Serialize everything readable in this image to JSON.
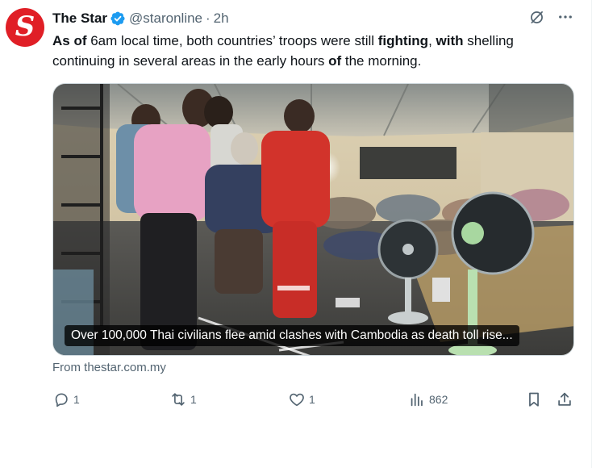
{
  "account": {
    "display_name": "The Star",
    "handle": "@staronline",
    "separator": "·",
    "time": "2h",
    "avatar_letter": "S",
    "avatar_color": "#e01f26",
    "verified_color": "#1d9bf0"
  },
  "tweet": {
    "segments": [
      {
        "text": "As of",
        "bold": true
      },
      {
        "text": " 6am local time, both countries’ troops were still ",
        "bold": false
      },
      {
        "text": "fighting",
        "bold": true
      },
      {
        "text": ", ",
        "bold": false
      },
      {
        "text": "with",
        "bold": true
      },
      {
        "text": " shelling continuing in several areas in the early hours ",
        "bold": false
      },
      {
        "text": "of",
        "bold": true
      },
      {
        "text": " the morning.",
        "bold": false
      }
    ]
  },
  "card": {
    "caption": "Over 100,000 Thai civilians flee amid clashes with Cambodia as death toll rise...",
    "source": "From thestar.com.my"
  },
  "actions": {
    "reply_count": "1",
    "repost_count": "1",
    "like_count": "1",
    "views_count": "862"
  },
  "icons": {
    "grok": "grok-icon",
    "more": "more-icon",
    "reply": "reply-icon",
    "repost": "repost-icon",
    "like": "like-icon",
    "views": "views-icon",
    "bookmark": "bookmark-icon",
    "share": "share-icon"
  },
  "colors": {
    "text": "#0f1419",
    "muted": "#536471",
    "border": "#cfd9de"
  }
}
